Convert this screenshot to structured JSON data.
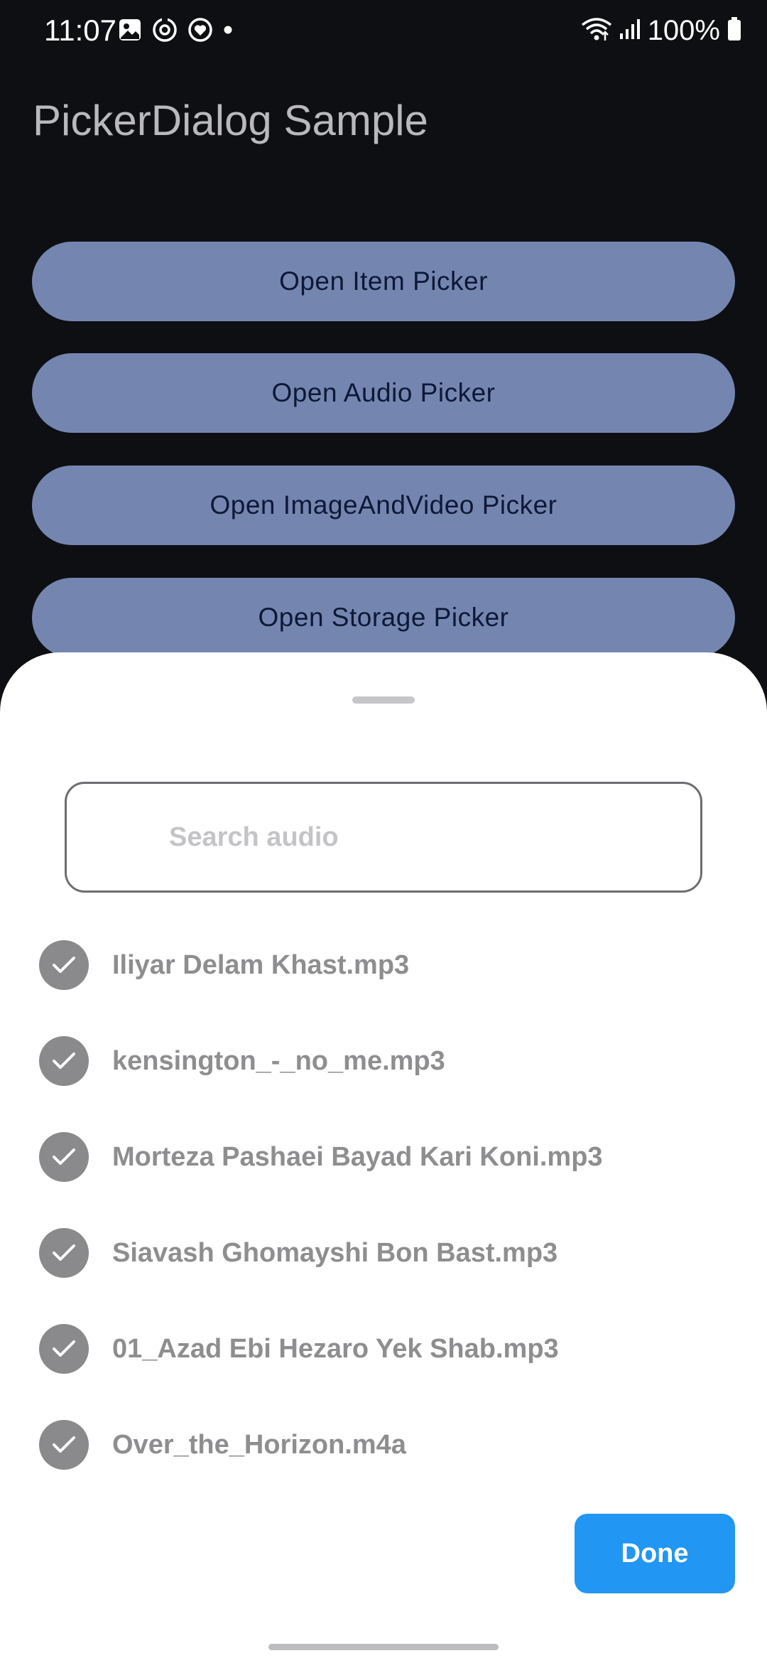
{
  "status_bar": {
    "time": "11:07",
    "battery_text": "100%",
    "left_icons": [
      "gallery-icon",
      "sync-icon",
      "health-icon",
      "dot-icon"
    ],
    "right_icons": [
      "wifi-icon",
      "signal-icon",
      "battery-icon"
    ]
  },
  "app": {
    "title": "PickerDialog Sample"
  },
  "buttons": [
    {
      "label": "Open Item Picker"
    },
    {
      "label": "Open Audio Picker"
    },
    {
      "label": "Open ImageAndVideo Picker"
    },
    {
      "label": "Open Storage Picker"
    }
  ],
  "sheet": {
    "search": {
      "placeholder": "Search audio",
      "value": ""
    },
    "items": [
      {
        "name": "Iliyar Delam Khast.mp3",
        "selected": true
      },
      {
        "name": "kensington_-_no_me.mp3",
        "selected": true
      },
      {
        "name": "Morteza Pashaei Bayad Kari Koni.mp3",
        "selected": true
      },
      {
        "name": "Siavash Ghomayshi Bon Bast.mp3",
        "selected": true
      },
      {
        "name": "01_Azad Ebi Hezaro Yek Shab.mp3",
        "selected": true
      },
      {
        "name": "Over_the_Horizon.m4a",
        "selected": true
      }
    ],
    "done_label": "Done"
  },
  "colors": {
    "background": "#0e0f12",
    "button": "#7486b0",
    "button_text": "#0d1838",
    "accent": "#2196f3",
    "check": "#8a8a8c"
  }
}
